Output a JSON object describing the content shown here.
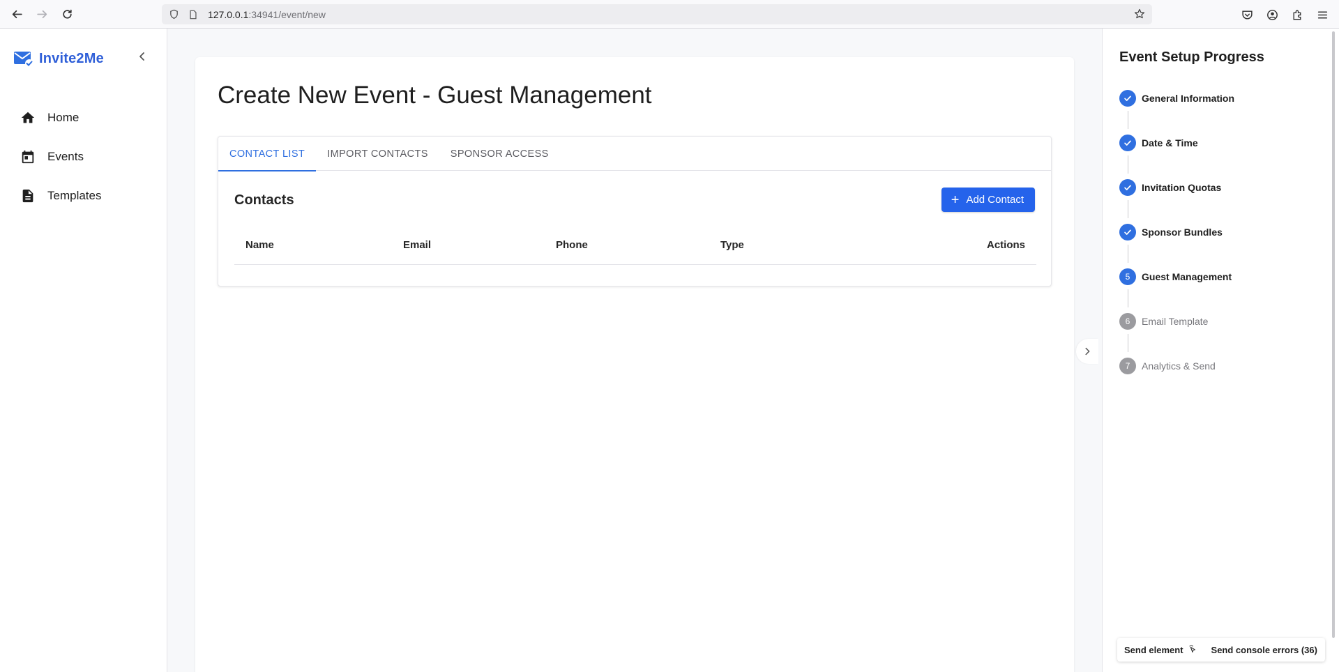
{
  "browser": {
    "url_host": "127.0.0.1",
    "url_path": ":34941/event/new"
  },
  "sidebar": {
    "brand": "Invite2Me",
    "items": [
      {
        "label": "Home",
        "icon": "home-icon"
      },
      {
        "label": "Events",
        "icon": "calendar-icon"
      },
      {
        "label": "Templates",
        "icon": "document-icon"
      }
    ]
  },
  "main": {
    "title": "Create New Event - Guest Management",
    "tabs": [
      {
        "label": "CONTACT LIST",
        "active": true
      },
      {
        "label": "IMPORT CONTACTS",
        "active": false
      },
      {
        "label": "SPONSOR ACCESS",
        "active": false
      }
    ],
    "contacts_title": "Contacts",
    "add_contact_label": "Add Contact",
    "table_headers": [
      "Name",
      "Email",
      "Phone",
      "Type",
      "Actions"
    ]
  },
  "progress": {
    "title": "Event Setup Progress",
    "steps": [
      {
        "marker": "",
        "label": "General Information",
        "state": "done"
      },
      {
        "marker": "",
        "label": "Date & Time",
        "state": "done"
      },
      {
        "marker": "",
        "label": "Invitation Quotas",
        "state": "done"
      },
      {
        "marker": "",
        "label": "Sponsor Bundles",
        "state": "done"
      },
      {
        "marker": "5",
        "label": "Guest Management",
        "state": "current"
      },
      {
        "marker": "6",
        "label": "Email Template",
        "state": "pending"
      },
      {
        "marker": "7",
        "label": "Analytics & Send",
        "state": "pending"
      }
    ]
  },
  "devtools": {
    "send_element": "Send element",
    "send_console_errors": "Send console errors (36)"
  },
  "colors": {
    "accent": "#2f6fe0",
    "button": "#2563eb",
    "pending": "#9b9b9f"
  }
}
